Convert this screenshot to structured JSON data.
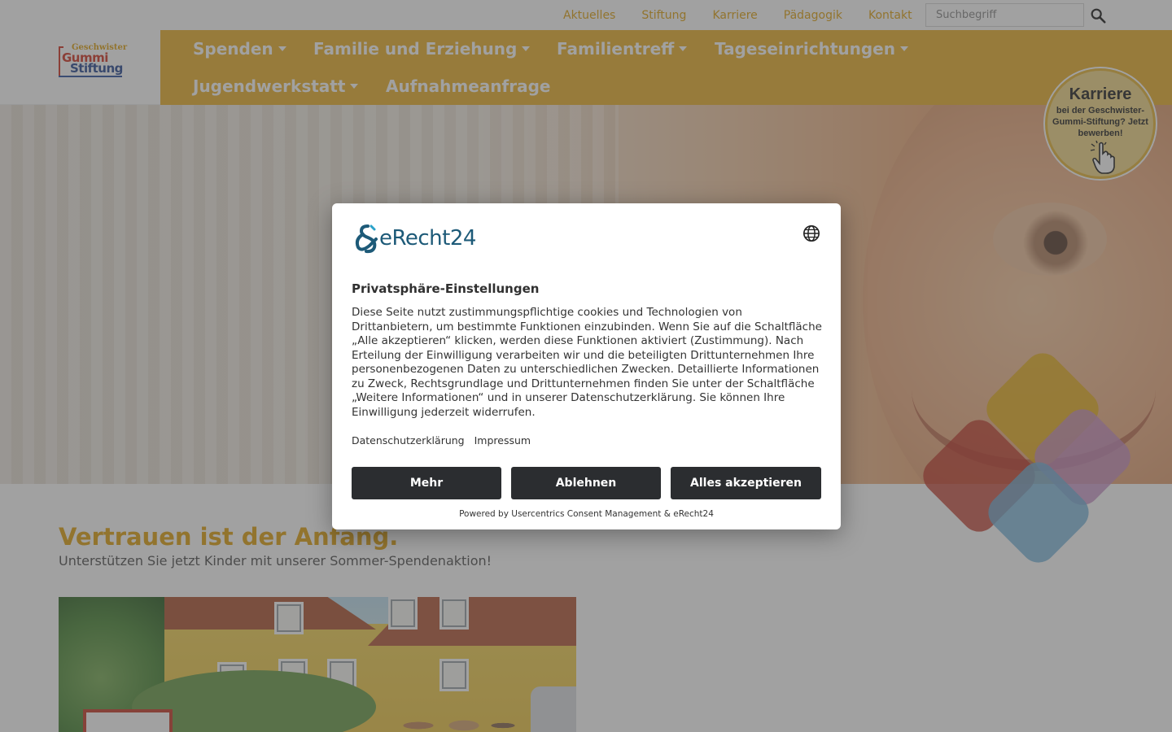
{
  "topbar": {
    "links": [
      "Aktuelles",
      "Stiftung",
      "Karriere",
      "Pädagogik",
      "Kontakt"
    ],
    "search_placeholder": "Suchbegriff",
    "search_icon": "search-icon"
  },
  "logo": {
    "line1": "Geschwister",
    "line2": "Gummi",
    "line3": "Stiftung"
  },
  "nav": {
    "items": [
      {
        "label": "Spenden",
        "dropdown": true
      },
      {
        "label": "Familie und Erziehung",
        "dropdown": true
      },
      {
        "label": "Familientreff",
        "dropdown": true
      },
      {
        "label": "Tageseinrichtungen",
        "dropdown": true
      },
      {
        "label": "Jugendwerkstatt",
        "dropdown": true
      },
      {
        "label": "Aufnahmeanfrage",
        "dropdown": false
      }
    ]
  },
  "karriere_badge": {
    "title": "Karriere",
    "text": "bei der Geschwister-Gummi-Stiftung? Jetzt bewerben!",
    "icon": "pointer-hand-icon"
  },
  "content": {
    "title": "Vertrauen ist der Anfang.",
    "subtitle": "Unterstützen Sie jetzt Kinder mit unserer Sommer-Spendenaktion!"
  },
  "consent": {
    "brand": "eRecht24",
    "title": "Privatsphäre-Einstellungen",
    "body": "Diese Seite nutzt zustimmungspflichtige cookies und Technologien von Drittanbietern, um bestimmte Funktionen einzubinden. Wenn Sie auf die Schaltfläche „Alle akzeptieren“ klicken, werden diese Funktionen aktiviert (Zustimmung). Nach Erteilung der Einwilligung verarbeiten wir und die beteiligten Drittunternehmen Ihre personenbezogenen Daten zu unterschiedlichen Zwecken. Detaillierte Informationen zu Zweck, Rechtsgrundlage und Drittunternehmen finden Sie unter der Schaltfläche „Weitere Informationen“ und in unserer Datenschutzerklärung. Sie können Ihre Einwilligung jederzeit widerrufen.",
    "links": {
      "privacy": "Datenschutzerklärung",
      "imprint": "Impressum"
    },
    "buttons": {
      "more": "Mehr",
      "decline": "Ablehnen",
      "accept": "Alles akzeptieren"
    },
    "powered_by": "Powered by Usercentrics Consent Management & eRecht24",
    "language_icon": "globe-icon"
  },
  "colors": {
    "accent": "#e0a419",
    "nav_bg": "#eab333",
    "button_dark": "#2b2d30",
    "brand_blue": "#1d5a78",
    "diamond_yellow": "#e8b21c",
    "diamond_red": "#c0392b",
    "diamond_pink": "#c58fc4",
    "diamond_blue": "#6fb2d8"
  }
}
